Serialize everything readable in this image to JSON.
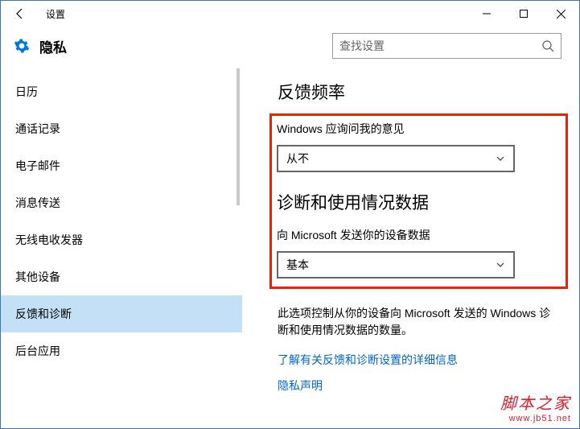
{
  "titlebar": {
    "title": "设置"
  },
  "header": {
    "page_title": "隐私",
    "search_placeholder": "查找设置"
  },
  "sidebar": {
    "items": [
      {
        "label": "日历"
      },
      {
        "label": "通话记录"
      },
      {
        "label": "电子邮件"
      },
      {
        "label": "消息传送"
      },
      {
        "label": "无线电收发器"
      },
      {
        "label": "其他设备"
      },
      {
        "label": "反馈和诊断"
      },
      {
        "label": "后台应用"
      }
    ],
    "selected_index": 6
  },
  "content": {
    "section1_title": "反馈频率",
    "feedback_label": "Windows 应询问我的意见",
    "feedback_value": "从不",
    "section2_title": "诊断和使用情况数据",
    "diag_label": "向 Microsoft 发送你的设备数据",
    "diag_value": "基本",
    "description": "此选项控制从你的设备向 Microsoft 发送的 Windows 诊断和使用情况数据的数量。",
    "link1": "了解有关反馈和诊断设置的详细信息",
    "link2": "隐私声明"
  },
  "watermark": {
    "line1": "脚本之家",
    "line2": "www.jb51.net"
  }
}
